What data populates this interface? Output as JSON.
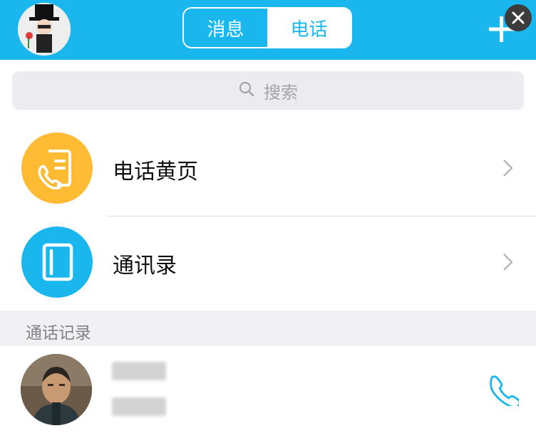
{
  "header": {
    "tabs": [
      {
        "label": "消息",
        "active": false
      },
      {
        "label": "电话",
        "active": true
      }
    ],
    "accent_color": "#1ab7ef"
  },
  "search": {
    "placeholder": "搜索",
    "icon": "search-icon"
  },
  "menu": [
    {
      "label": "电话黄页",
      "icon": "yellow-pages-icon",
      "color": "#ffbb33"
    },
    {
      "label": "通讯录",
      "icon": "address-book-icon",
      "color": "#1ab7ef"
    }
  ],
  "call_history": {
    "title": "通话记录",
    "entries": [
      {
        "name": "",
        "number": "",
        "blurred": true
      }
    ]
  }
}
